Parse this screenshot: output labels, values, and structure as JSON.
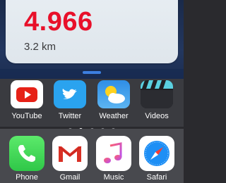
{
  "widget": {
    "value": "4.966",
    "distance": "3.2 km",
    "value_color": "#e8102a"
  },
  "apps": [
    {
      "label": "YouTube",
      "icon": "youtube-icon"
    },
    {
      "label": "Twitter",
      "icon": "twitter-icon"
    },
    {
      "label": "Weather",
      "icon": "weather-icon"
    },
    {
      "label": "Videos",
      "icon": "videos-icon"
    }
  ],
  "page_indicator": {
    "pages": 5,
    "current": 2
  },
  "dock": [
    {
      "label": "Phone",
      "icon": "phone-icon"
    },
    {
      "label": "Gmail",
      "icon": "gmail-icon"
    },
    {
      "label": "Music",
      "icon": "music-icon"
    },
    {
      "label": "Safari",
      "icon": "safari-icon"
    }
  ]
}
